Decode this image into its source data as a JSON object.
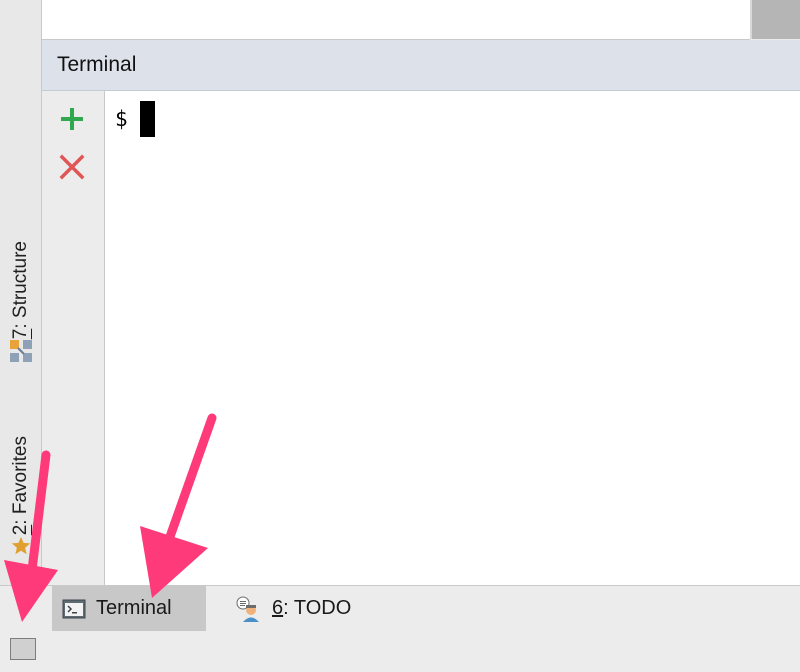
{
  "left_strip": {
    "tabs": [
      {
        "number": "7",
        "rest": ": Structure",
        "icon": "structure-icon"
      },
      {
        "number": "2",
        "rest": ": Favorites",
        "icon": "star-icon"
      }
    ]
  },
  "terminal_window": {
    "title": "Terminal",
    "prompt": "$",
    "actions": [
      {
        "name": "new-session",
        "icon": "plus-icon",
        "color": "#2fa84f"
      },
      {
        "name": "close-session",
        "icon": "close-icon",
        "color": "#e05555"
      }
    ]
  },
  "bottom_bar": {
    "tabs": [
      {
        "label": "Terminal",
        "icon": "terminal-icon",
        "active": true
      },
      {
        "number": "6",
        "rest": ": TODO",
        "icon": "todo-icon",
        "active": false
      }
    ]
  },
  "colors": {
    "header_bg": "#dde2ea",
    "active_tab_bg": "#c8c8c8",
    "annotation_arrow": "#ff3a7a"
  }
}
